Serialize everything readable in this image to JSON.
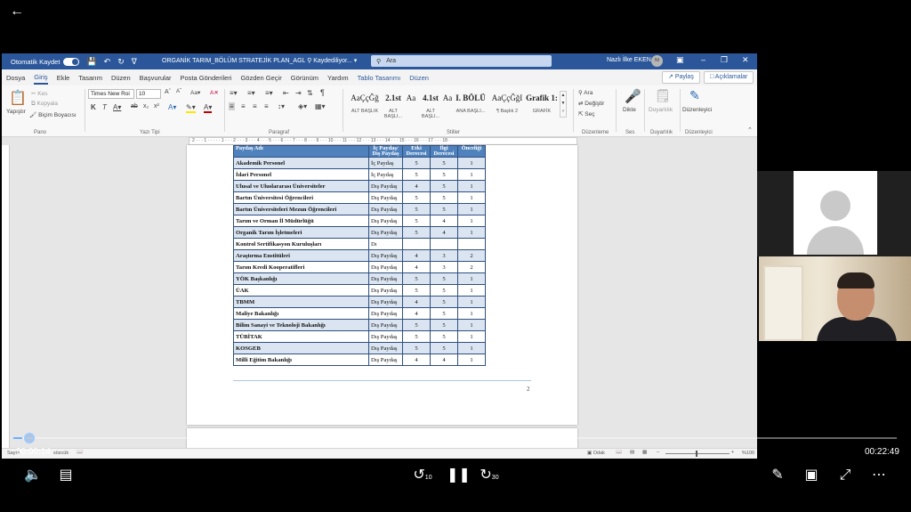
{
  "player": {
    "back_icon": "arrow-left-icon",
    "current_time": "00:00:14",
    "total_time": "00:22:49",
    "progress_fraction": 0.01,
    "rewind_label": "10",
    "forward_label": "30"
  },
  "word": {
    "autosave_label": "Otomatik Kaydet",
    "doc_title": "ORGANİK TARIM_BÖLÜM STRATEJİK PLAN_AGL",
    "save_status": "Kaydediliyor...",
    "search_placeholder": "Ara",
    "user_name": "Nazlı İlke EKEN",
    "user_initials": "NI",
    "menu": [
      "Dosya",
      "Giriş",
      "Ekle",
      "Tasarım",
      "Düzen",
      "Başvurular",
      "Posta Gönderileri",
      "Gözden Geçir",
      "Görünüm",
      "Yardım",
      "Tablo Tasarımı",
      "Düzen"
    ],
    "share_label": "Paylaş",
    "comments_label": "Açıklamalar",
    "ribbon": {
      "paste_label": "Yapıştır",
      "cut_label": "Kes",
      "copy_label": "Kopyala",
      "format_painter_label": "Biçim Boyacısı",
      "clipboard_group": "Pano",
      "font_name": "Times New Roi",
      "font_size": "10",
      "font_group": "Yazı Tipi",
      "paragraph_group": "Paragraf",
      "styles_group": "Stiller",
      "styles": [
        {
          "sample": "AaÇçĞğ",
          "name": "ALT BAŞLIK"
        },
        {
          "sample": "2.1st",
          "name": "ALT BAŞLI..."
        },
        {
          "sample": "Aa",
          "name": ""
        },
        {
          "sample": "4.1st",
          "name": "ALT BAŞLI..."
        },
        {
          "sample": "Aa",
          "name": ""
        },
        {
          "sample": "I. BÖLÜ",
          "name": "ANA BAŞLI..."
        },
        {
          "sample": "AaÇçĞğI",
          "name": "¶ Başlık 2"
        },
        {
          "sample": "Grafik 1:",
          "name": "GRAFİK"
        }
      ],
      "find_label": "Ara",
      "replace_label": "Değiştir",
      "select_label": "Seç",
      "editing_group": "Düzenleme",
      "dictate_label": "Dikte",
      "voice_group": "Ses",
      "sensitivity_label": "Duyarlılık",
      "sensitivity_group": "Duyarlılık",
      "editor_label": "Düzenleyici",
      "editor_group": "Düzenleyici"
    },
    "ruler_text": "· 2 · · · 1 · · · · · 1 · · · 2 · · · 3 · · · 4 · · · 5 · · · 6 · · · 7 · · · 8 · · · 9 · · · 10 · · · 11 · · · 12 · · · 13 · · · 14 · · · 15 · · · 16 · · · 17 · · · 18 ·",
    "table": {
      "headers": [
        "Paydaş Adı",
        "İç Paydaş/ Dış Paydaş",
        "Etki Derecesi",
        "İlgi Derecesi",
        "Önceliği"
      ],
      "rows": [
        [
          "Akademik Personel",
          "İç Paydaş",
          "5",
          "5",
          "1"
        ],
        [
          "İdari Personel",
          "İç Paydaş",
          "5",
          "5",
          "1"
        ],
        [
          "Ulusal ve Uluslararası Üniversiteler",
          "Dış Paydaş",
          "4",
          "5",
          "1"
        ],
        [
          "Bartın Üniversitesi Öğrencileri",
          "Dış Paydaş",
          "5",
          "5",
          "1"
        ],
        [
          "Bartın Üniversiteleri Mezun Öğrencileri",
          "Dış Paydaş",
          "5",
          "5",
          "1"
        ],
        [
          "Tarım ve Orman İl Müdürlüğü",
          "Dış Paydaş",
          "5",
          "4",
          "1"
        ],
        [
          "Organik Tarım İşletmeleri",
          "Dış Paydaş",
          "5",
          "4",
          "1"
        ],
        [
          "Kontrol Sertifikasyon Kuruluşları",
          "Dı",
          "",
          "",
          ""
        ],
        [
          "Araştırma Enstitüleri",
          "Dış Paydaş",
          "4",
          "3",
          "2"
        ],
        [
          "Tarım Kredi Kooperatifleri",
          "Dış Paydaş",
          "4",
          "3",
          "2"
        ],
        [
          "YÖK Başkanlığı",
          "Dış Paydaş",
          "5",
          "5",
          "1"
        ],
        [
          "ÜAK",
          "Dış Paydaş",
          "5",
          "5",
          "1"
        ],
        [
          "TBMM",
          "Dış Paydaş",
          "4",
          "5",
          "1"
        ],
        [
          "Maliye Bakanlığı",
          "Dış Paydaş",
          "4",
          "5",
          "1"
        ],
        [
          "Bilim Sanayi ve Teknoloji Bakanlığı",
          "Dış Paydaş",
          "5",
          "5",
          "1"
        ],
        [
          "TÜBİTAK",
          "Dış Paydaş",
          "5",
          "5",
          "1"
        ],
        [
          "KOSGEB",
          "Dış Paydaş",
          "5",
          "5",
          "1"
        ],
        [
          "Milli Eğitim Bakanlığı",
          "Dış Paydaş",
          "4",
          "4",
          "1"
        ]
      ]
    },
    "page_number": "2",
    "status_left": "Sayfa",
    "status_words": "sözcük",
    "status_focus": "Odak",
    "zoom": "%100"
  },
  "colors": {
    "word_blue": "#2b579a",
    "table_header": "#4f81bd",
    "table_band": "#dbe5f1",
    "progress": "#6ab0ff"
  }
}
